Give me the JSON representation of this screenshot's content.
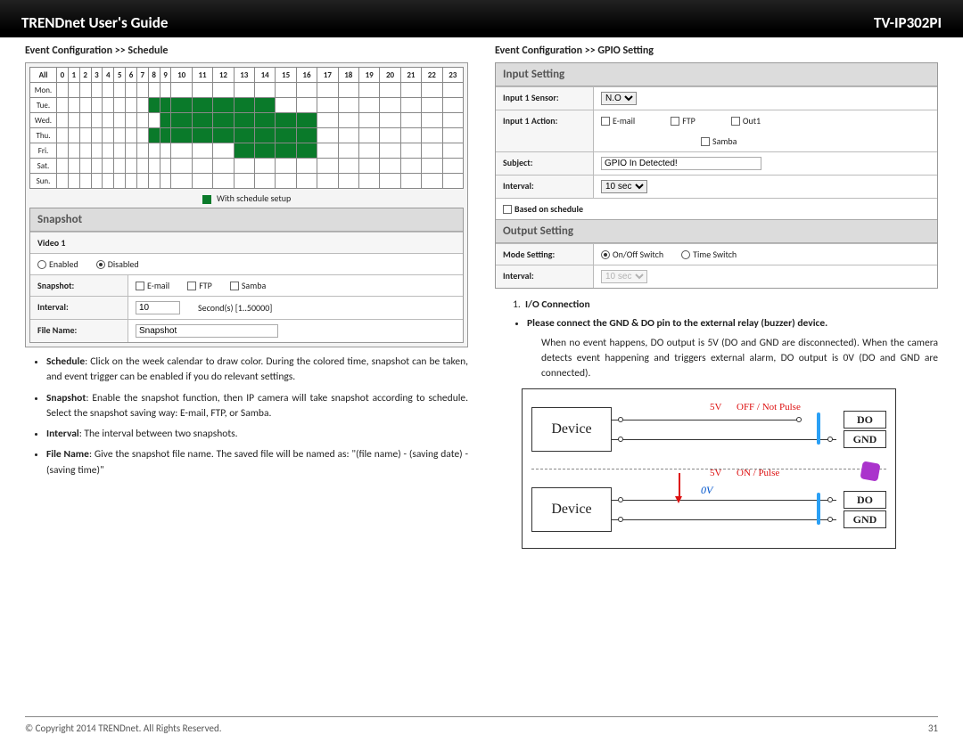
{
  "header": {
    "left": "TRENDnet User's Guide",
    "right": "TV-IP302PI"
  },
  "left": {
    "title": "Event Configuration >> Schedule",
    "hours": [
      "All",
      "0",
      "1",
      "2",
      "3",
      "4",
      "5",
      "6",
      "7",
      "8",
      "9",
      "10",
      "11",
      "12",
      "13",
      "14",
      "15",
      "16",
      "17",
      "18",
      "19",
      "20",
      "21",
      "22",
      "23"
    ],
    "days": [
      "Mon.",
      "Tue.",
      "Wed.",
      "Thu.",
      "Fri.",
      "Sat.",
      "Sun."
    ],
    "legend": "With schedule setup",
    "snapshot": {
      "head": "Snapshot",
      "video": "Video 1",
      "enabled_label": "Enabled",
      "disabled_label": "Disabled",
      "row_snapshot": "Snapshot:",
      "opts": {
        "email": "E-mail",
        "ftp": "FTP",
        "samba": "Samba"
      },
      "row_interval": "Interval:",
      "interval_value": "10",
      "interval_suffix": "Second(s) [1..50000]",
      "row_filename": "File Name:",
      "filename_value": "Snapshot"
    },
    "bullets": [
      {
        "b": "Schedule",
        "t": ": Click on the week calendar to draw color. During the colored time, snapshot can be taken, and event trigger can be enabled if you do relevant settings."
      },
      {
        "b": "Snapshot",
        "t": ": Enable the snapshot function, then IP camera will take snapshot according to schedule. Select the snapshot saving way: E-mail, FTP, or Samba."
      },
      {
        "b": "Interval",
        "t": ": The interval between two snapshots."
      },
      {
        "b": "File Name",
        "t": ": Give the snapshot file name. The saved file will be named as: \"(file name) - (saving date) - (saving time)\""
      }
    ]
  },
  "right": {
    "title": "Event Configuration >> GPIO Setting",
    "input": {
      "head": "Input Setting",
      "sensor_label": "Input 1 Sensor:",
      "sensor_value": "N.O",
      "action_label": "Input 1 Action:",
      "opts": {
        "email": "E-mail",
        "ftp": "FTP",
        "out1": "Out1",
        "samba": "Samba"
      },
      "subject_label": "Subject:",
      "subject_value": "GPIO In Detected!",
      "interval_label": "Interval:",
      "interval_value": "10 sec",
      "based": "Based on schedule"
    },
    "output": {
      "head": "Output Setting",
      "mode_label": "Mode Setting:",
      "mode_on": "On/Off Switch",
      "mode_time": "Time Switch",
      "interval_label": "Interval:",
      "interval_value": "10 sec"
    },
    "io": {
      "num": "1.",
      "title": "I/O Connection",
      "bullet": "Please connect the GND & DO pin to the external relay (buzzer) device.",
      "desc": "When no event happens, DO output is 5V (DO and GND are disconnected). When the camera detects event happening and triggers external alarm, DO output is 0V (DO and GND are connected)."
    },
    "diagram": {
      "device": "Device",
      "v5": "5V",
      "v0": "0V",
      "off": "OFF / Not Pulse",
      "on": "ON / Pulse",
      "do": "DO",
      "gnd": "GND"
    }
  },
  "footer": {
    "copy": "© Copyright 2014 TRENDnet.  All Rights Reserved.",
    "page": "31"
  },
  "chart_data": {
    "type": "heatmap",
    "title": "Schedule (hours marked per weekday)",
    "x_categories": [
      "0",
      "1",
      "2",
      "3",
      "4",
      "5",
      "6",
      "7",
      "8",
      "9",
      "10",
      "11",
      "12",
      "13",
      "14",
      "15",
      "16",
      "17",
      "18",
      "19",
      "20",
      "21",
      "22",
      "23"
    ],
    "y_categories": [
      "Mon.",
      "Tue.",
      "Wed.",
      "Thu.",
      "Fri.",
      "Sat.",
      "Sun."
    ],
    "on_cells": {
      "Mon.": [],
      "Tue.": [
        8,
        9,
        10,
        11,
        12,
        13,
        14
      ],
      "Wed.": [
        9,
        10,
        11,
        12,
        13,
        14,
        15,
        16
      ],
      "Thu.": [
        8,
        9,
        10,
        11,
        12,
        13,
        14,
        15,
        16
      ],
      "Fri.": [
        13,
        14,
        15,
        16
      ],
      "Sat.": [],
      "Sun.": []
    },
    "legend": [
      {
        "label": "With schedule setup",
        "color": "#0a7a2a"
      }
    ]
  }
}
